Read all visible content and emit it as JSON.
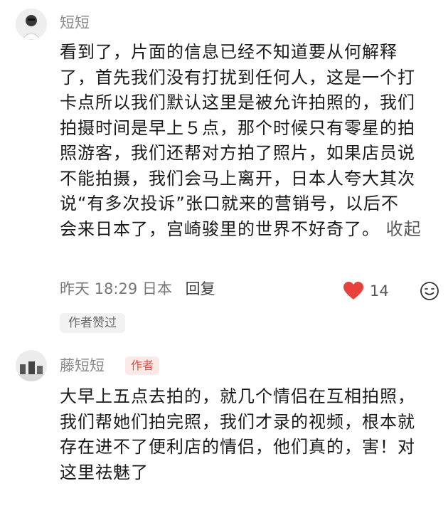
{
  "comment1": {
    "username": "短短",
    "text": "看到了，片面的信息已经不知道要从何解释\n了，首先我们没有打扰到任何人，这是一个打\n卡点所以我们默认这里是被允许拍照的，我们\n拍摄时间是早上５点，那个时候只有零星的拍\n照游客，我们还帮对方拍了照片，如果店员说\n不能拍摄，我们会马上离开，日本人夸大其次\n说“有多次投诉”张口就来的营销号，以后不\n会来日本了，宫崎骏里的世界不好奇了。",
    "expand_label": "收起",
    "meta_time": "昨天 18:29 日本",
    "reply_label": "回复",
    "like_count": "14",
    "author_liked": "作者赞过"
  },
  "comment2": {
    "username": "藤短短",
    "badge": "作者",
    "text": "大早上五点去拍的，就几个情侣在互相拍照，\n我们帮她们拍完照，我们才录的视频，根本就\n存在进不了便利店的情侣，他们真的，害！对\n这里祛魅了"
  },
  "icons": {
    "like": "heart-icon",
    "emoji": "smiley-icon"
  },
  "colors": {
    "like": "#e8403a",
    "badge_text": "#e0513f",
    "badge_bg": "#fde9e7"
  }
}
